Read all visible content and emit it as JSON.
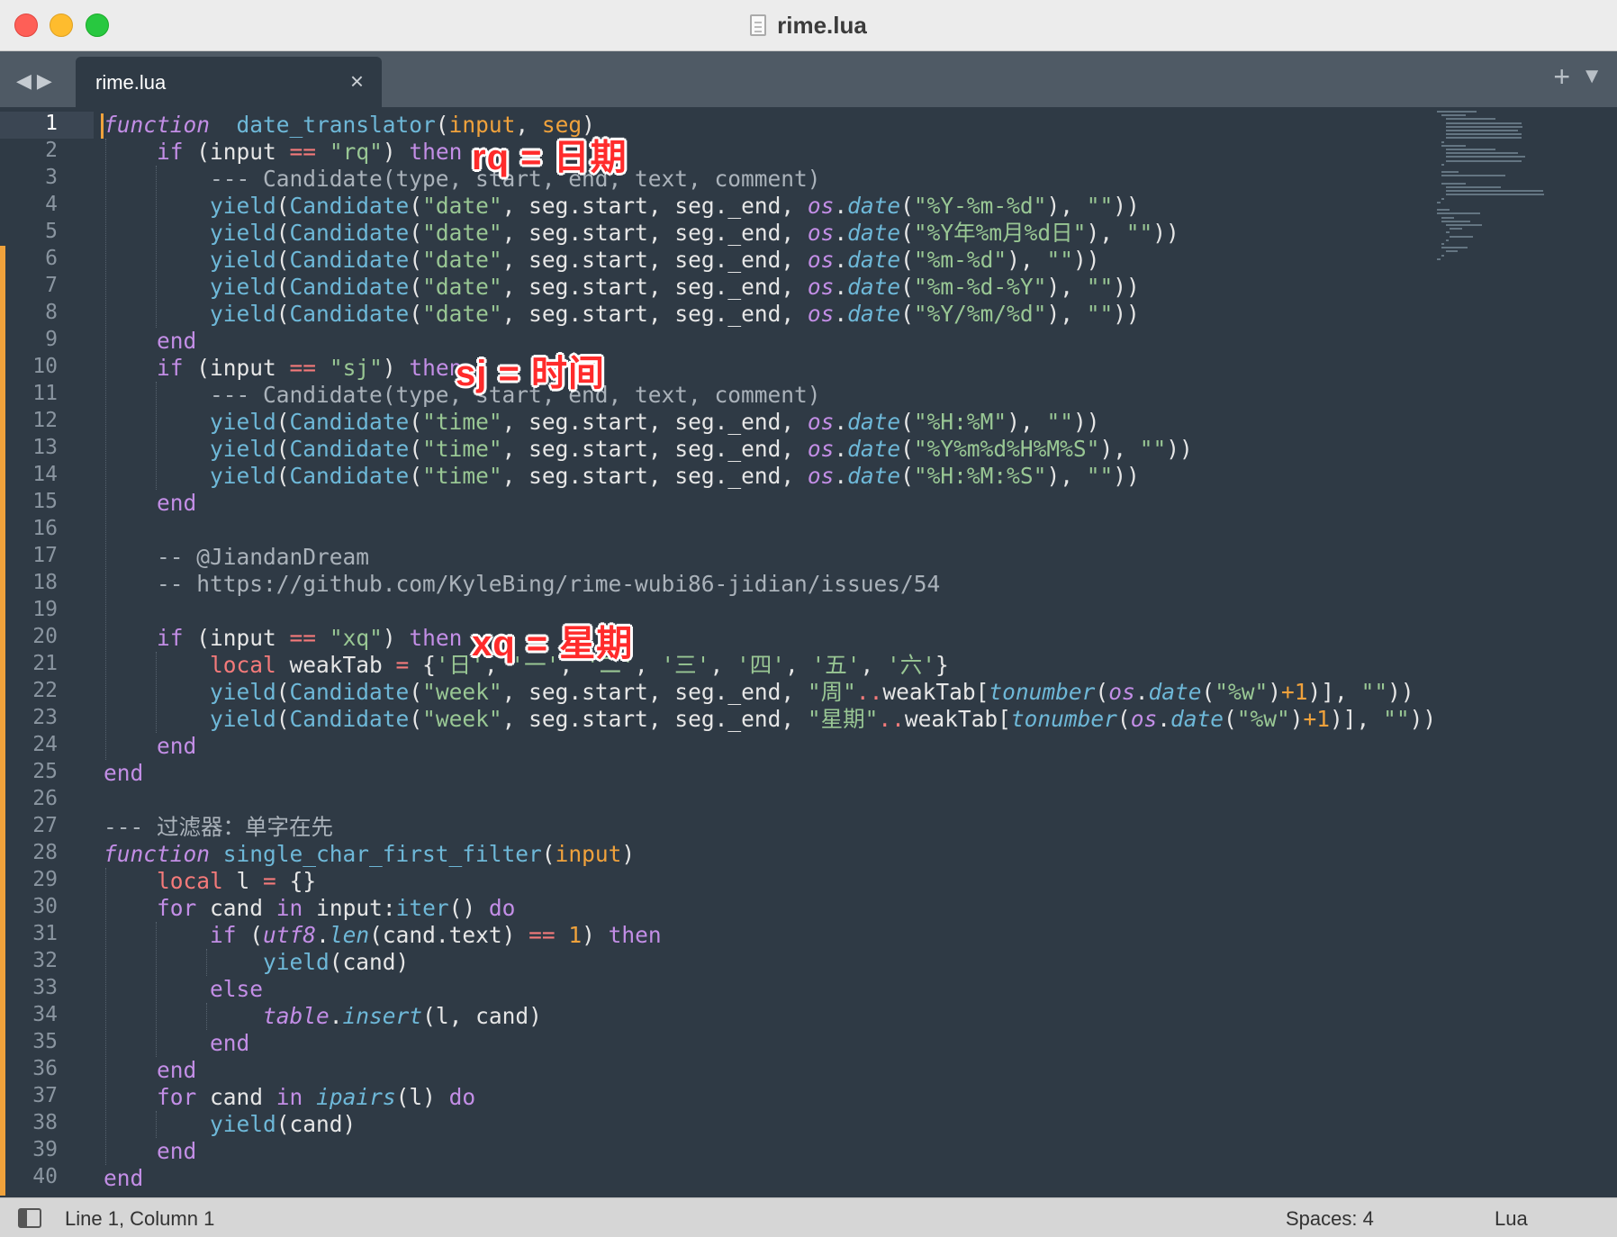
{
  "window": {
    "title": "rime.lua"
  },
  "tabs": [
    {
      "label": "rime.lua",
      "close": "×"
    }
  ],
  "tabbar": {
    "nav_back": "◀",
    "nav_forward": "▶",
    "add": "+",
    "menu": "▼"
  },
  "editor": {
    "current_line": 1,
    "line_numbers": [
      "1",
      "2",
      "3",
      "4",
      "5",
      "6",
      "7",
      "8",
      "9",
      "10",
      "11",
      "12",
      "13",
      "14",
      "15",
      "16",
      "17",
      "18",
      "19",
      "20",
      "21",
      "22",
      "23",
      "24",
      "25",
      "26",
      "27",
      "28",
      "29",
      "30",
      "31",
      "32",
      "33",
      "34",
      "35",
      "36",
      "37",
      "38",
      "39",
      "40"
    ],
    "lines": [
      [
        [
          "kw",
          "function"
        ],
        [
          "",
          "  "
        ],
        [
          "fn",
          "date_translator"
        ],
        [
          "br",
          "("
        ],
        [
          "prm",
          "input"
        ],
        [
          "br",
          ", "
        ],
        [
          "prm",
          "seg"
        ],
        [
          "br",
          ")"
        ]
      ],
      [
        [
          "",
          "    "
        ],
        [
          "ctl",
          "if"
        ],
        [
          "",
          " (input "
        ],
        [
          "op",
          "=="
        ],
        [
          "",
          " "
        ],
        [
          "str",
          "\"rq\""
        ],
        [
          "",
          ") "
        ],
        [
          "ctl",
          "then"
        ]
      ],
      [
        [
          "",
          "        "
        ],
        [
          "cmt",
          "--- Candidate(type, start, end, text, comment)"
        ]
      ],
      [
        [
          "",
          "        "
        ],
        [
          "fn",
          "yield"
        ],
        [
          "",
          "("
        ],
        [
          "cls",
          "Candidate"
        ],
        [
          "",
          "("
        ],
        [
          "str",
          "\"date\""
        ],
        [
          "",
          ", seg.start, seg._end, "
        ],
        [
          "lib",
          "os"
        ],
        [
          "",
          "."
        ],
        [
          "bi",
          "date"
        ],
        [
          "",
          "("
        ],
        [
          "str",
          "\"%Y-%m-%d\""
        ],
        [
          "",
          "), "
        ],
        [
          "str",
          "\"\""
        ],
        [
          "",
          "))"
        ]
      ],
      [
        [
          "",
          "        "
        ],
        [
          "fn",
          "yield"
        ],
        [
          "",
          "("
        ],
        [
          "cls",
          "Candidate"
        ],
        [
          "",
          "("
        ],
        [
          "str",
          "\"date\""
        ],
        [
          "",
          ", seg.start, seg._end, "
        ],
        [
          "lib",
          "os"
        ],
        [
          "",
          "."
        ],
        [
          "bi",
          "date"
        ],
        [
          "",
          "("
        ],
        [
          "str",
          "\"%Y年%m月%d日\""
        ],
        [
          "",
          "), "
        ],
        [
          "str",
          "\"\""
        ],
        [
          "",
          "))"
        ]
      ],
      [
        [
          "",
          "        "
        ],
        [
          "fn",
          "yield"
        ],
        [
          "",
          "("
        ],
        [
          "cls",
          "Candidate"
        ],
        [
          "",
          "("
        ],
        [
          "str",
          "\"date\""
        ],
        [
          "",
          ", seg.start, seg._end, "
        ],
        [
          "lib",
          "os"
        ],
        [
          "",
          "."
        ],
        [
          "bi",
          "date"
        ],
        [
          "",
          "("
        ],
        [
          "str",
          "\"%m-%d\""
        ],
        [
          "",
          "), "
        ],
        [
          "str",
          "\"\""
        ],
        [
          "",
          "))"
        ]
      ],
      [
        [
          "",
          "        "
        ],
        [
          "fn",
          "yield"
        ],
        [
          "",
          "("
        ],
        [
          "cls",
          "Candidate"
        ],
        [
          "",
          "("
        ],
        [
          "str",
          "\"date\""
        ],
        [
          "",
          ", seg.start, seg._end, "
        ],
        [
          "lib",
          "os"
        ],
        [
          "",
          "."
        ],
        [
          "bi",
          "date"
        ],
        [
          "",
          "("
        ],
        [
          "str",
          "\"%m-%d-%Y\""
        ],
        [
          "",
          "), "
        ],
        [
          "str",
          "\"\""
        ],
        [
          "",
          "))"
        ]
      ],
      [
        [
          "",
          "        "
        ],
        [
          "fn",
          "yield"
        ],
        [
          "",
          "("
        ],
        [
          "cls",
          "Candidate"
        ],
        [
          "",
          "("
        ],
        [
          "str",
          "\"date\""
        ],
        [
          "",
          ", seg.start, seg._end, "
        ],
        [
          "lib",
          "os"
        ],
        [
          "",
          "."
        ],
        [
          "bi",
          "date"
        ],
        [
          "",
          "("
        ],
        [
          "str",
          "\"%Y/%m/%d\""
        ],
        [
          "",
          "), "
        ],
        [
          "str",
          "\"\""
        ],
        [
          "",
          "))"
        ]
      ],
      [
        [
          "",
          "    "
        ],
        [
          "ctl",
          "end"
        ]
      ],
      [
        [
          "",
          "    "
        ],
        [
          "ctl",
          "if"
        ],
        [
          "",
          " (input "
        ],
        [
          "op",
          "=="
        ],
        [
          "",
          " "
        ],
        [
          "str",
          "\"sj\""
        ],
        [
          "",
          ") "
        ],
        [
          "ctl",
          "then"
        ]
      ],
      [
        [
          "",
          "        "
        ],
        [
          "cmt",
          "--- Candidate(type, start, end, text, comment)"
        ]
      ],
      [
        [
          "",
          "        "
        ],
        [
          "fn",
          "yield"
        ],
        [
          "",
          "("
        ],
        [
          "cls",
          "Candidate"
        ],
        [
          "",
          "("
        ],
        [
          "str",
          "\"time\""
        ],
        [
          "",
          ", seg.start, seg._end, "
        ],
        [
          "lib",
          "os"
        ],
        [
          "",
          "."
        ],
        [
          "bi",
          "date"
        ],
        [
          "",
          "("
        ],
        [
          "str",
          "\"%H:%M\""
        ],
        [
          "",
          "), "
        ],
        [
          "str",
          "\"\""
        ],
        [
          "",
          "))"
        ]
      ],
      [
        [
          "",
          "        "
        ],
        [
          "fn",
          "yield"
        ],
        [
          "",
          "("
        ],
        [
          "cls",
          "Candidate"
        ],
        [
          "",
          "("
        ],
        [
          "str",
          "\"time\""
        ],
        [
          "",
          ", seg.start, seg._end, "
        ],
        [
          "lib",
          "os"
        ],
        [
          "",
          "."
        ],
        [
          "bi",
          "date"
        ],
        [
          "",
          "("
        ],
        [
          "str",
          "\"%Y%m%d%H%M%S\""
        ],
        [
          "",
          "), "
        ],
        [
          "str",
          "\"\""
        ],
        [
          "",
          "))"
        ]
      ],
      [
        [
          "",
          "        "
        ],
        [
          "fn",
          "yield"
        ],
        [
          "",
          "("
        ],
        [
          "cls",
          "Candidate"
        ],
        [
          "",
          "("
        ],
        [
          "str",
          "\"time\""
        ],
        [
          "",
          ", seg.start, seg._end, "
        ],
        [
          "lib",
          "os"
        ],
        [
          "",
          "."
        ],
        [
          "bi",
          "date"
        ],
        [
          "",
          "("
        ],
        [
          "str",
          "\"%H:%M:%S\""
        ],
        [
          "",
          "), "
        ],
        [
          "str",
          "\"\""
        ],
        [
          "",
          "))"
        ]
      ],
      [
        [
          "",
          "    "
        ],
        [
          "ctl",
          "end"
        ]
      ],
      [],
      [
        [
          "",
          "    "
        ],
        [
          "cmt",
          "-- @JiandanDream"
        ]
      ],
      [
        [
          "",
          "    "
        ],
        [
          "cmt",
          "-- https://github.com/KyleBing/rime-wubi86-jidian/issues/54"
        ]
      ],
      [],
      [
        [
          "",
          "    "
        ],
        [
          "ctl",
          "if"
        ],
        [
          "",
          " (input "
        ],
        [
          "op",
          "=="
        ],
        [
          "",
          " "
        ],
        [
          "str",
          "\"xq\""
        ],
        [
          "",
          ") "
        ],
        [
          "ctl",
          "then"
        ]
      ],
      [
        [
          "",
          "        "
        ],
        [
          "lc",
          "local"
        ],
        [
          "",
          " weakTab "
        ],
        [
          "op",
          "="
        ],
        [
          "",
          " {"
        ],
        [
          "str",
          "'日'"
        ],
        [
          "",
          ", "
        ],
        [
          "str",
          "'一'"
        ],
        [
          "",
          ", "
        ],
        [
          "str",
          "'二'"
        ],
        [
          "",
          ", "
        ],
        [
          "str",
          "'三'"
        ],
        [
          "",
          ", "
        ],
        [
          "str",
          "'四'"
        ],
        [
          "",
          ", "
        ],
        [
          "str",
          "'五'"
        ],
        [
          "",
          ", "
        ],
        [
          "str",
          "'六'"
        ],
        [
          "",
          "}"
        ]
      ],
      [
        [
          "",
          "        "
        ],
        [
          "fn",
          "yield"
        ],
        [
          "",
          "("
        ],
        [
          "cls",
          "Candidate"
        ],
        [
          "",
          "("
        ],
        [
          "str",
          "\"week\""
        ],
        [
          "",
          ", seg.start, seg._end, "
        ],
        [
          "str",
          "\"周\""
        ],
        [
          "op",
          ".."
        ],
        [
          "",
          "weakTab["
        ],
        [
          "bi",
          "tonumber"
        ],
        [
          "",
          "("
        ],
        [
          "lib",
          "os"
        ],
        [
          "",
          "."
        ],
        [
          "bi",
          "date"
        ],
        [
          "",
          "("
        ],
        [
          "str",
          "\"%w\""
        ],
        [
          "",
          ")"
        ],
        [
          "num",
          "+1"
        ],
        [
          "",
          ")], "
        ],
        [
          "str",
          "\"\""
        ],
        [
          "",
          "))"
        ]
      ],
      [
        [
          "",
          "        "
        ],
        [
          "fn",
          "yield"
        ],
        [
          "",
          "("
        ],
        [
          "cls",
          "Candidate"
        ],
        [
          "",
          "("
        ],
        [
          "str",
          "\"week\""
        ],
        [
          "",
          ", seg.start, seg._end, "
        ],
        [
          "str",
          "\"星期\""
        ],
        [
          "op",
          ".."
        ],
        [
          "",
          "weakTab["
        ],
        [
          "bi",
          "tonumber"
        ],
        [
          "",
          "("
        ],
        [
          "lib",
          "os"
        ],
        [
          "",
          "."
        ],
        [
          "bi",
          "date"
        ],
        [
          "",
          "("
        ],
        [
          "str",
          "\"%w\""
        ],
        [
          "",
          ")"
        ],
        [
          "num",
          "+1"
        ],
        [
          "",
          ")], "
        ],
        [
          "str",
          "\"\""
        ],
        [
          "",
          "))"
        ]
      ],
      [
        [
          "",
          "    "
        ],
        [
          "ctl",
          "end"
        ]
      ],
      [
        [
          "ctl",
          "end"
        ]
      ],
      [],
      [
        [
          "cmt",
          "--- 过滤器：单字在先"
        ]
      ],
      [
        [
          "kw",
          "function"
        ],
        [
          "",
          " "
        ],
        [
          "fn",
          "single_char_first_filter"
        ],
        [
          "",
          "("
        ],
        [
          "prm",
          "input"
        ],
        [
          "",
          ")"
        ]
      ],
      [
        [
          "",
          "    "
        ],
        [
          "lc",
          "local"
        ],
        [
          "",
          " l "
        ],
        [
          "op",
          "="
        ],
        [
          "",
          " {}"
        ]
      ],
      [
        [
          "",
          "    "
        ],
        [
          "ctl",
          "for"
        ],
        [
          "",
          " cand "
        ],
        [
          "ctl",
          "in"
        ],
        [
          "",
          " input:"
        ],
        [
          "fn",
          "iter"
        ],
        [
          "",
          "() "
        ],
        [
          "ctl",
          "do"
        ]
      ],
      [
        [
          "",
          "        "
        ],
        [
          "ctl",
          "if"
        ],
        [
          "",
          " ("
        ],
        [
          "lib",
          "utf8"
        ],
        [
          "",
          "."
        ],
        [
          "bi",
          "len"
        ],
        [
          "",
          "(cand.text) "
        ],
        [
          "op",
          "=="
        ],
        [
          "",
          " "
        ],
        [
          "num",
          "1"
        ],
        [
          "",
          ") "
        ],
        [
          "ctl",
          "then"
        ]
      ],
      [
        [
          "",
          "            "
        ],
        [
          "fn",
          "yield"
        ],
        [
          "",
          "(cand)"
        ]
      ],
      [
        [
          "",
          "        "
        ],
        [
          "ctl",
          "else"
        ]
      ],
      [
        [
          "",
          "            "
        ],
        [
          "lib",
          "table"
        ],
        [
          "",
          "."
        ],
        [
          "bi",
          "insert"
        ],
        [
          "",
          "(l, cand)"
        ]
      ],
      [
        [
          "",
          "        "
        ],
        [
          "ctl",
          "end"
        ]
      ],
      [
        [
          "",
          "    "
        ],
        [
          "ctl",
          "end"
        ]
      ],
      [
        [
          "",
          "    "
        ],
        [
          "ctl",
          "for"
        ],
        [
          "",
          " cand "
        ],
        [
          "ctl",
          "in"
        ],
        [
          "",
          " "
        ],
        [
          "bi",
          "ipairs"
        ],
        [
          "",
          "(l) "
        ],
        [
          "ctl",
          "do"
        ]
      ],
      [
        [
          "",
          "        "
        ],
        [
          "fn",
          "yield"
        ],
        [
          "",
          "(cand)"
        ]
      ],
      [
        [
          "",
          "    "
        ],
        [
          "ctl",
          "end"
        ]
      ],
      [
        [
          "ctl",
          "end"
        ]
      ]
    ]
  },
  "annotations": [
    {
      "text": "rq = 日期",
      "line": 2
    },
    {
      "text": "sj = 时间",
      "line": 10
    },
    {
      "text": "xq = 星期",
      "line": 20
    }
  ],
  "status": {
    "position": "Line 1, Column 1",
    "indentation": "Spaces: 4",
    "syntax": "Lua"
  }
}
